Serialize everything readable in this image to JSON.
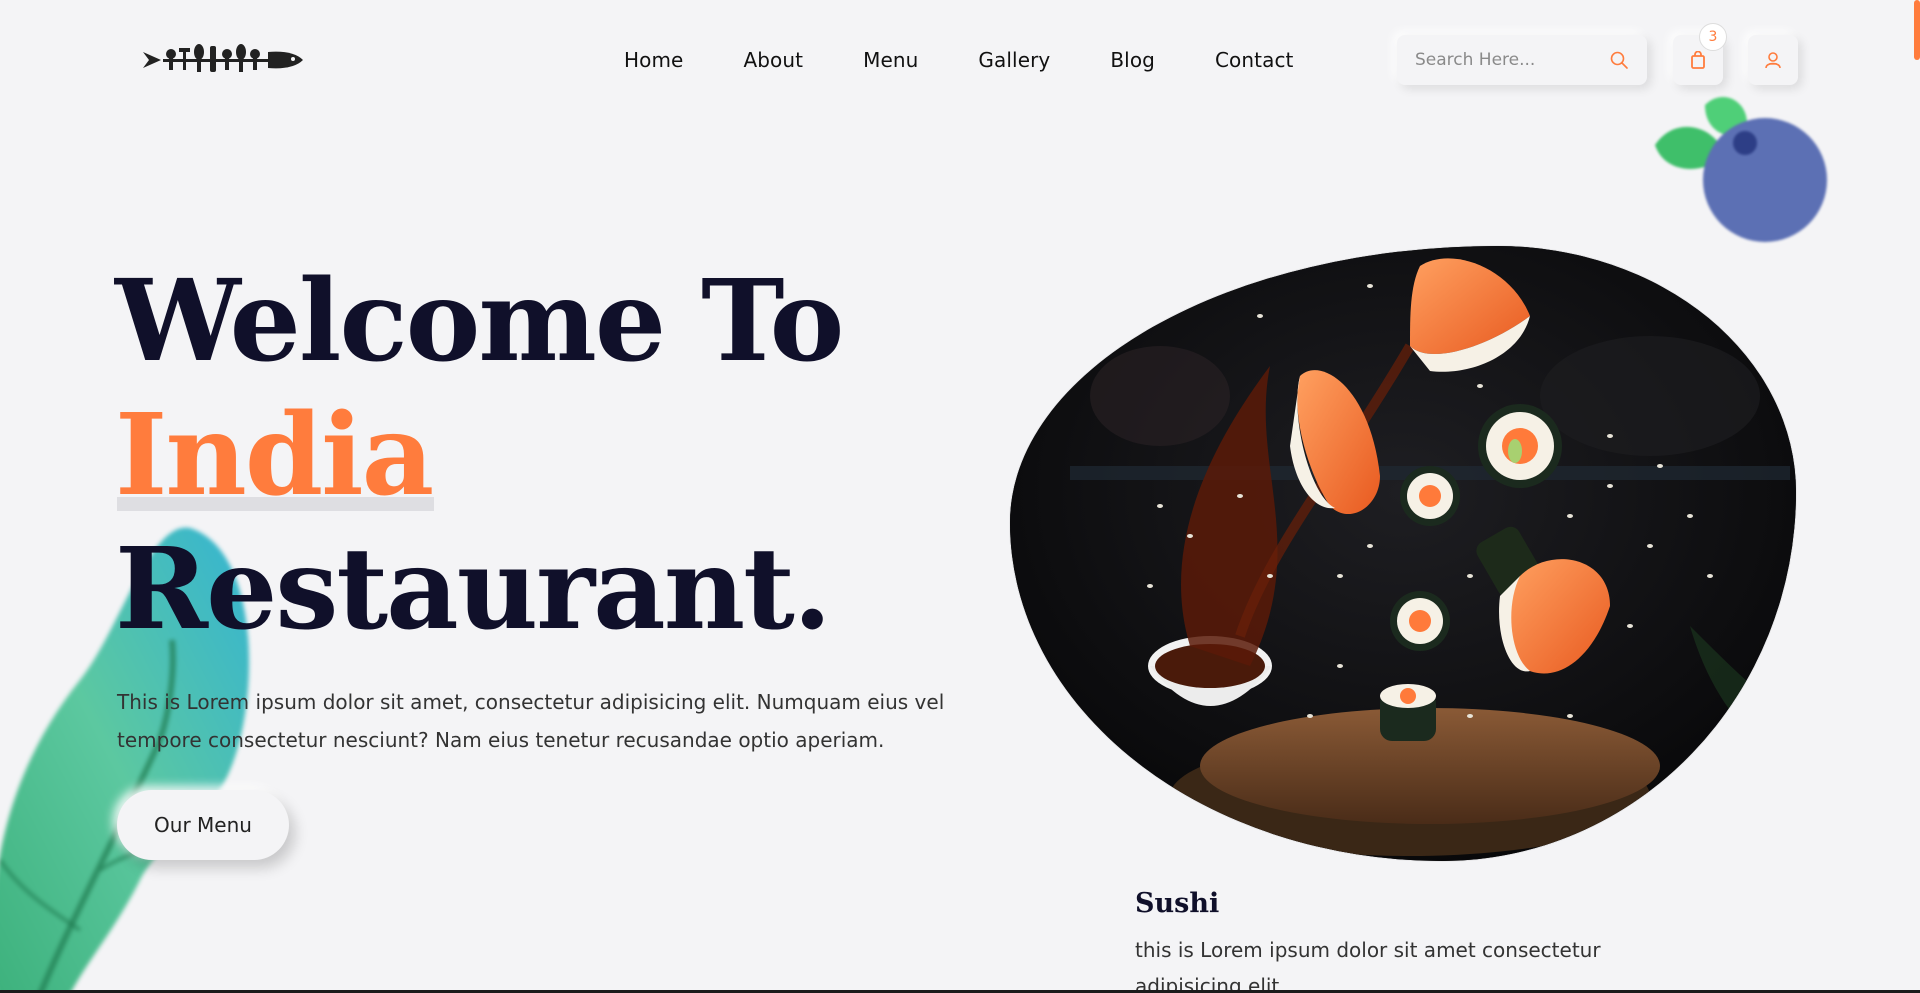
{
  "header": {
    "nav": [
      "Home",
      "About",
      "Menu",
      "Gallery",
      "Blog",
      "Contact"
    ],
    "search_placeholder": "Search Here...",
    "cart_count": "3",
    "icons": {
      "logo": "cutlery-fish-logo",
      "search": "search-icon",
      "cart": "shopping-bag-icon",
      "user": "user-icon"
    }
  },
  "hero": {
    "title_line1": "Welcome To",
    "title_line2": "India",
    "title_line3": "Restaurant.",
    "description": "This is Lorem ipsum dolor sit amet, consectetur adipisicing elit. Numquam eius vel tempore consectetur nesciunt? Nam eius tenetur recusandae optio aperiam.",
    "button_label": "Our Menu"
  },
  "feature": {
    "title": "Sushi",
    "text": "this is Lorem ipsum dolor sit amet consectetur adipisicing elit."
  },
  "colors": {
    "accent": "#ff7c3d",
    "dark": "#10102a",
    "background": "#f4f4f6"
  }
}
